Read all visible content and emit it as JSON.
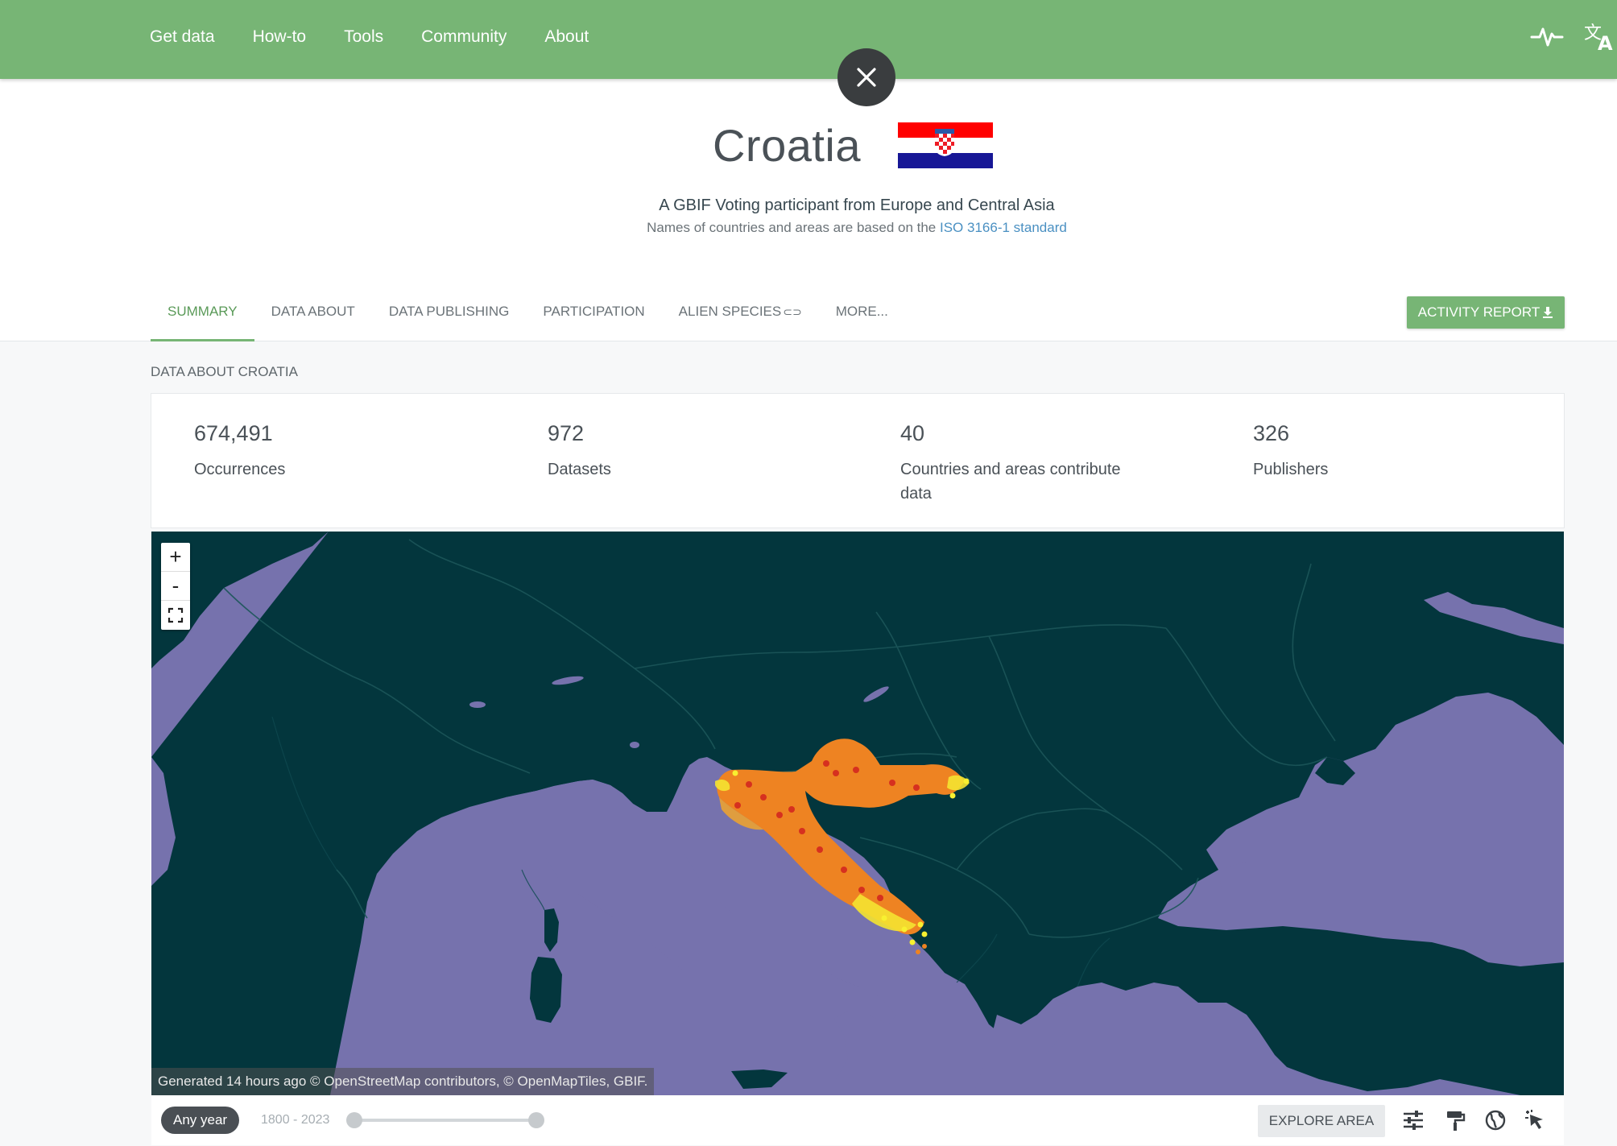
{
  "nav": {
    "items": [
      {
        "label": "Get data"
      },
      {
        "label": "How-to"
      },
      {
        "label": "Tools"
      },
      {
        "label": "Community"
      },
      {
        "label": "About"
      }
    ],
    "icons": [
      "pulse-icon",
      "translate-icon"
    ]
  },
  "close": {
    "icon": "close-icon"
  },
  "header": {
    "title": "Croatia",
    "subtitle": "A GBIF Voting participant from Europe and Central Asia",
    "iso_note_prefix": "Names of countries and areas are based on the ",
    "iso_note_link": "ISO 3166-1 standard"
  },
  "tabs": [
    {
      "label": "Summary",
      "active": true
    },
    {
      "label": "Data about",
      "active": false
    },
    {
      "label": "Data publishing",
      "active": false
    },
    {
      "label": "Participation",
      "active": false
    },
    {
      "label": "Alien species",
      "active": false,
      "icon": "link-icon"
    },
    {
      "label": "More...",
      "active": false
    }
  ],
  "activity_report": {
    "label": "Activity report",
    "icon": "download-icon"
  },
  "section_label": "Data about Croatia",
  "stats": [
    {
      "value": "674,491",
      "label": "Occurrences"
    },
    {
      "value": "972",
      "label": "Datasets"
    },
    {
      "value": "40",
      "label": "Countries and areas contribute data"
    },
    {
      "value": "326",
      "label": "Publishers"
    }
  ],
  "map": {
    "zoom_in": "+",
    "zoom_out": "-",
    "fullscreen_icon": "fullscreen-icon",
    "attribution": "Generated 14 hours ago © OpenStreetMap contributors, © OpenMapTiles, GBIF.",
    "colors": {
      "land": "#03363d",
      "sea": "#7672ad",
      "hex_low": "#f2e326",
      "hex_mid": "#ee8322",
      "hex_high": "#d6301f"
    }
  },
  "map_footer": {
    "any_year": "Any year",
    "year_range": "1800 - 2023",
    "explore_label": "Explore area",
    "tool_icons": [
      "filter-sliders-icon",
      "paint-roller-icon",
      "globe-icon",
      "cursor-select-icon"
    ]
  }
}
